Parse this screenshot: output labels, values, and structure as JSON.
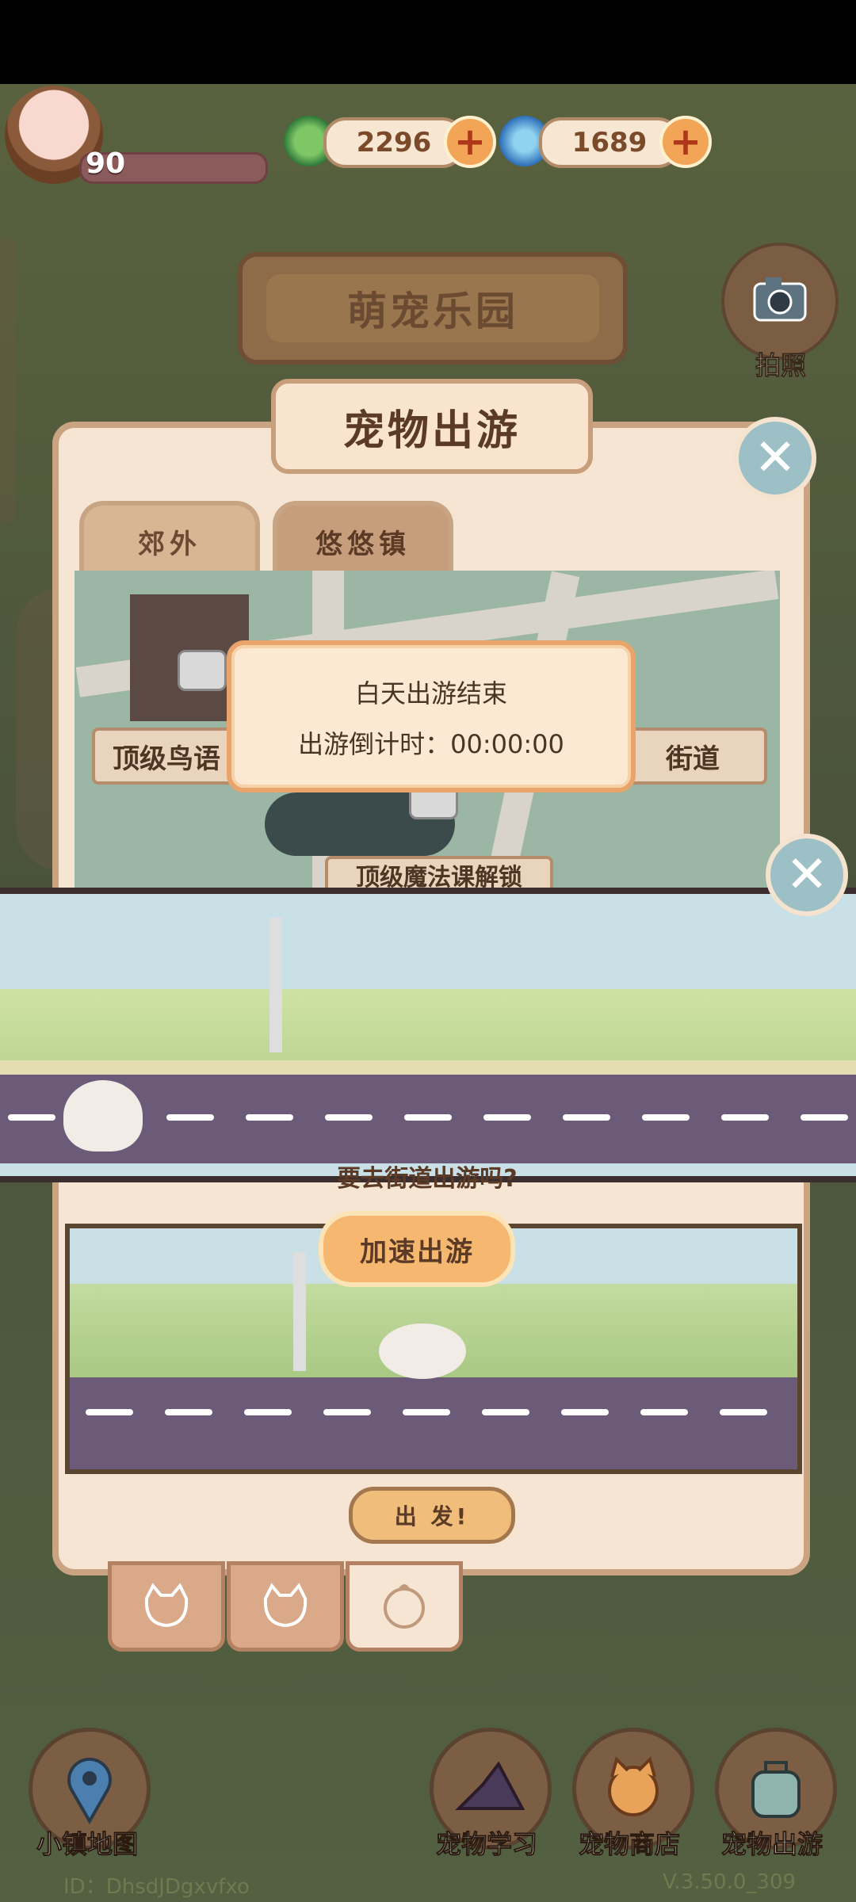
{
  "header": {
    "level": "90",
    "currency_leaf": "2296",
    "currency_swirl": "1689",
    "plus": "+"
  },
  "sign": {
    "title": "萌宠乐园"
  },
  "camera": {
    "label": "拍照"
  },
  "dialog": {
    "title": "宠物出游",
    "close": "✕",
    "tabs": [
      "郊外",
      "悠悠镇"
    ],
    "map": {
      "location_left": "顶级鸟语",
      "location_right": "街道",
      "location_bottom": "顶级魔法课解锁"
    },
    "popup": {
      "line1": "白天出游结束",
      "line2_label": "出游倒计时：",
      "line2_value": "00:00:00"
    },
    "question_partial": "要去街道出游吗?",
    "speed_button": "加速出游",
    "go_button": "出 发!"
  },
  "strip": {
    "close": "✕"
  },
  "pet_tabs": [
    "cat-face",
    "cat-face",
    "chick-face"
  ],
  "nav": {
    "town_map": "小镇地图",
    "pet_learning": "宠物学习",
    "pet_shop": "宠物商店",
    "pet_outing": "宠物出游"
  },
  "footer": {
    "id": "ID：DhsdJDgxvfxo",
    "version": "V.3.50.0_309"
  },
  "colors": {
    "accent_orange": "#f2a556",
    "dialog_bg": "#f5e5d2",
    "road": "#6c5b78"
  }
}
